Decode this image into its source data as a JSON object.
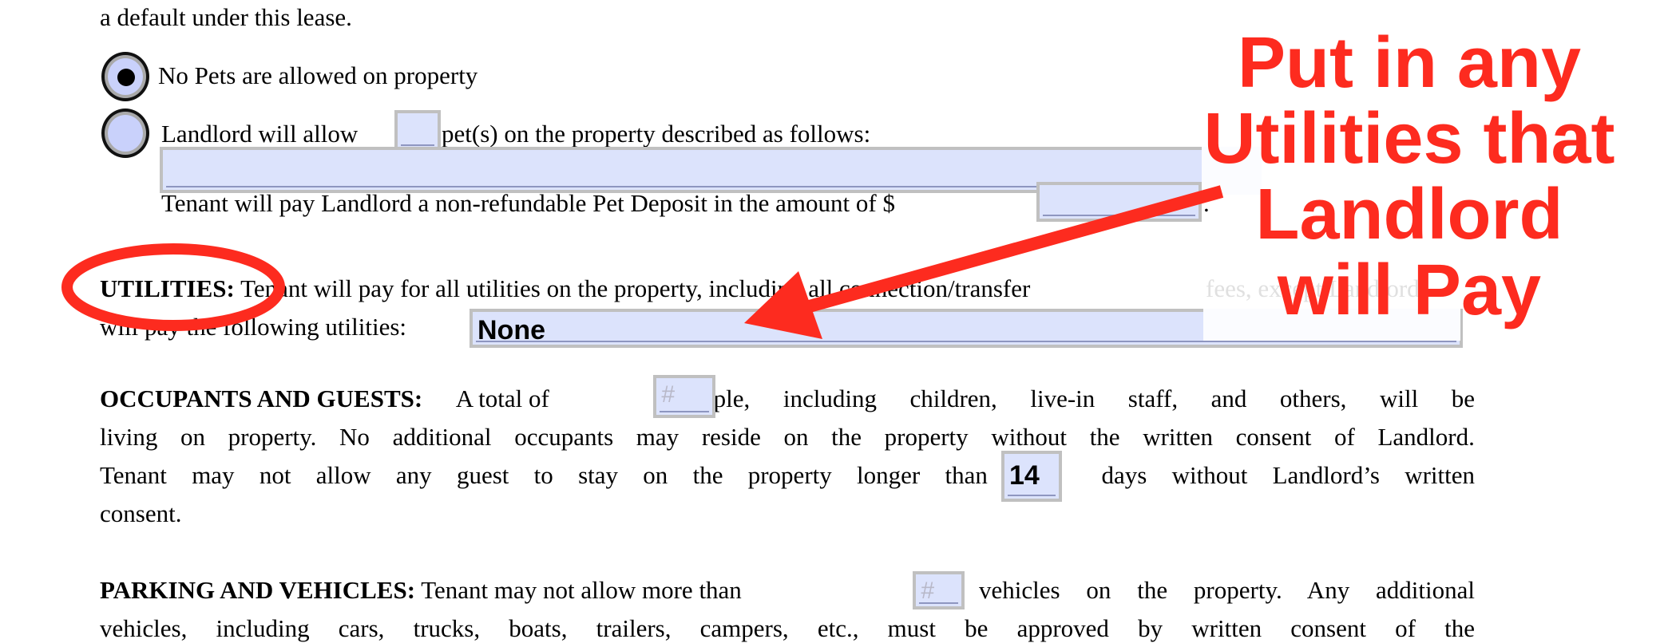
{
  "document": {
    "intro_line": "a default under this lease.",
    "pets": {
      "option_no_pets": {
        "label": "No Pets are allowed on property",
        "selected": true
      },
      "option_allow": {
        "label_before": "Landlord will allow",
        "label_after": "pet(s) on the property described as follows:",
        "selected": false
      },
      "pet_count_value": "",
      "pet_description_value": "",
      "deposit_text": "Tenant will pay Landlord a non-refundable Pet Deposit in the amount of $",
      "deposit_value": "",
      "deposit_period": "."
    },
    "utilities": {
      "heading": "UTILITIES:",
      "line1": "Tenant will pay for all utilities on the property, including all connection/transfer",
      "line1_hidden": "fees, except Landlord",
      "line2": "will pay the following utilities:",
      "field_value": "None"
    },
    "occupants": {
      "heading": "OCCUPANTS AND GUESTS:",
      "line1_before": "A total of",
      "occupant_count_placeholder": "#",
      "line1_after": [
        "people,",
        "including",
        "children,",
        "live-in",
        "staff,",
        "and",
        "others,",
        "will",
        "be"
      ],
      "line2": [
        "living",
        "on",
        "property.",
        "No",
        "additional",
        "occupants",
        "may",
        "reside",
        "on",
        "the",
        "property",
        "without",
        "the",
        "written",
        "consent",
        "of",
        "Landlord."
      ],
      "line3_before": [
        "Tenant",
        "may",
        "not",
        "allow",
        "any",
        "guest",
        "to",
        "stay",
        "on",
        "the",
        "property",
        "longer",
        "than"
      ],
      "guest_days_value": "14",
      "line3_after": [
        "days",
        "without",
        "Landlord’s",
        "written"
      ],
      "line4": "consent."
    },
    "parking": {
      "heading": "PARKING AND VEHICLES:",
      "line1_before": "Tenant may not allow more than",
      "vehicle_count_placeholder": "#",
      "line1_after": "vehicles on the property. Any additional",
      "line2": [
        "vehicles,",
        "including",
        "cars,",
        "trucks,",
        "boats,",
        "trailers,",
        "campers,",
        "etc.,",
        "must",
        "be",
        "approved",
        "by",
        "written",
        "consent",
        "of",
        "the"
      ]
    }
  },
  "annotation": {
    "lines": [
      "Put in any",
      "Utilities that",
      "Landlord",
      "will Pay"
    ],
    "color": "#fd2b1f"
  },
  "colors": {
    "field_fill": "#dce3fc",
    "field_border": "#c0c0c0",
    "radio_fill": "#c9d1fb"
  }
}
